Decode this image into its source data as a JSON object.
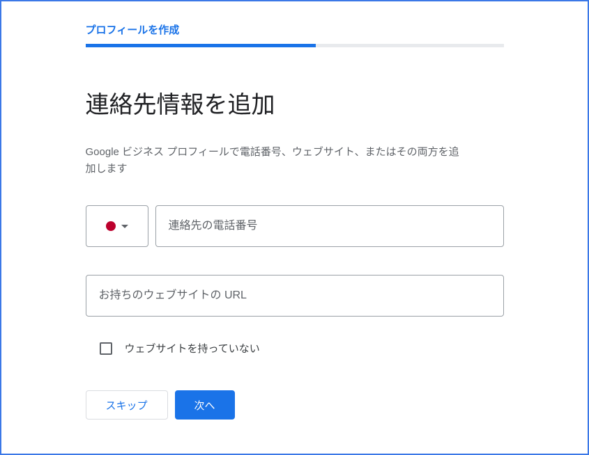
{
  "step_label": "プロフィールを作成",
  "progress_percent": 55,
  "title": "連絡先情報を追加",
  "description": "Google ビジネス プロフィールで電話番号、ウェブサイト、またはその両方を追加します",
  "phone": {
    "country_flag": "japan",
    "placeholder": "連絡先の電話番号",
    "value": ""
  },
  "website": {
    "placeholder": "お持ちのウェブサイトの URL",
    "value": ""
  },
  "checkbox": {
    "label": "ウェブサイトを持っていない",
    "checked": false
  },
  "buttons": {
    "skip": "スキップ",
    "next": "次へ"
  }
}
